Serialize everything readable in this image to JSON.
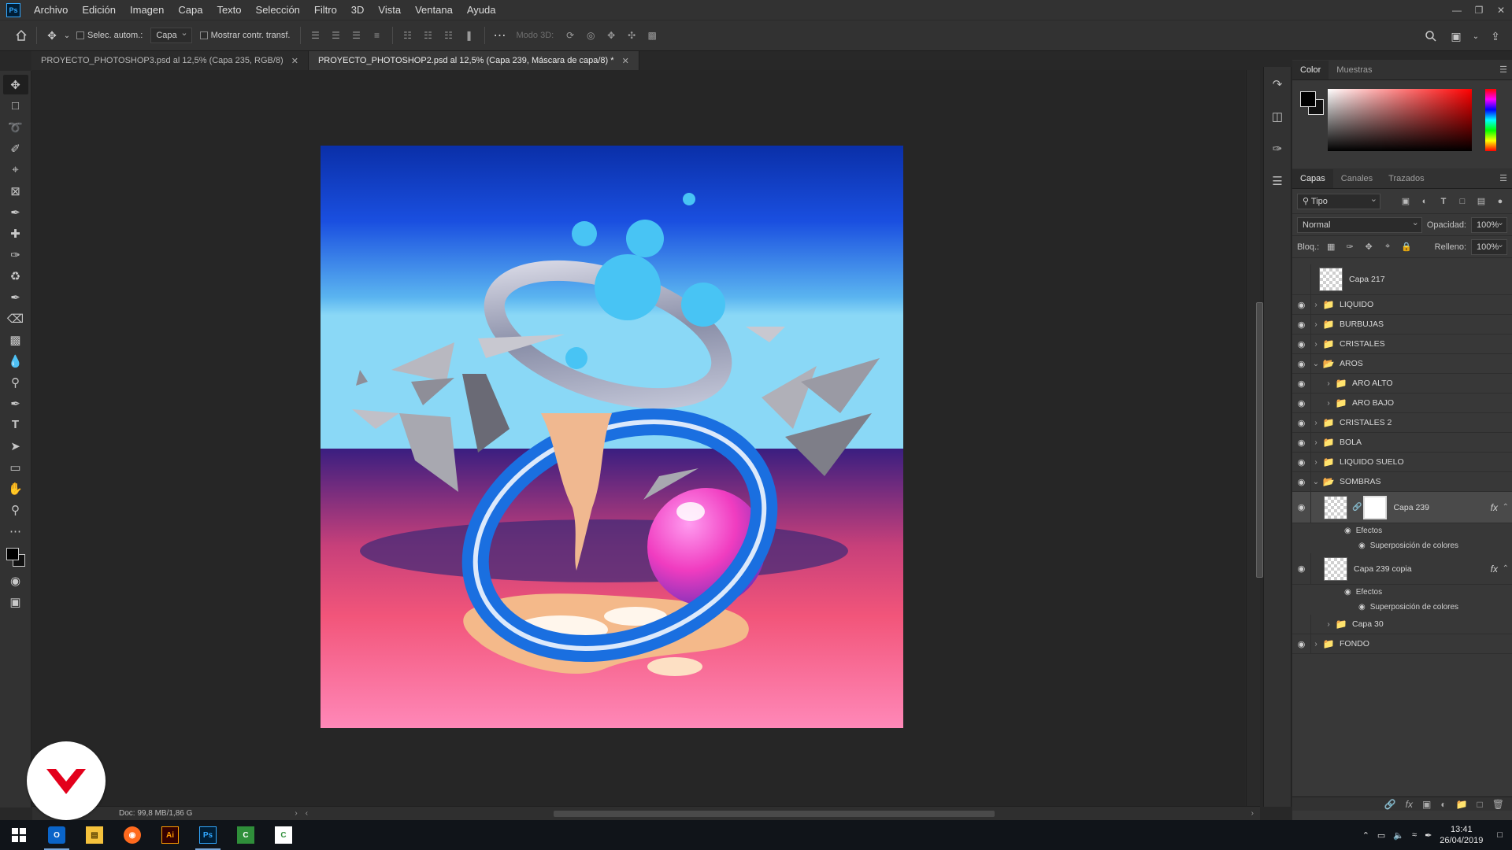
{
  "menubar": {
    "items": [
      "Archivo",
      "Edición",
      "Imagen",
      "Capa",
      "Texto",
      "Selección",
      "Filtro",
      "3D",
      "Vista",
      "Ventana",
      "Ayuda"
    ]
  },
  "options": {
    "auto_select_label": "Selec. autom.:",
    "auto_select_value": "Capa",
    "show_transform_label": "Mostrar contr. transf.",
    "mode3d_label": "Modo 3D:"
  },
  "tabs": [
    {
      "label": "PROYECTO_PHOTOSHOP3.psd al 12,5% (Capa 235, RGB/8)",
      "active": false
    },
    {
      "label": "PROYECTO_PHOTOSHOP2.psd al 12,5% (Capa 239, Máscara de capa/8) *",
      "active": true
    }
  ],
  "status": {
    "doc": "Doc: 99,8 MB/1,86 G"
  },
  "color_panel": {
    "tabs": [
      "Color",
      "Muestras"
    ],
    "foreground": "#000000",
    "background": "#111111"
  },
  "layers_panel": {
    "tabs": [
      "Capas",
      "Canales",
      "Trazados"
    ],
    "filter_value": "Tipo",
    "blend_mode": "Normal",
    "opacity_label": "Opacidad:",
    "opacity_value": "100%",
    "lock_label": "Bloq.:",
    "fill_label": "Relleno:",
    "fill_value": "100%",
    "layers": [
      {
        "name": "Capa 217",
        "type": "layer",
        "visible": false
      },
      {
        "name": "LIQUIDO",
        "type": "group",
        "visible": true
      },
      {
        "name": "BURBUJAS",
        "type": "group",
        "visible": true
      },
      {
        "name": "CRISTALES",
        "type": "group",
        "visible": true
      },
      {
        "name": "AROS",
        "type": "group",
        "visible": true,
        "expanded": true
      },
      {
        "name": "ARO ALTO",
        "type": "group",
        "visible": true,
        "indent": 1
      },
      {
        "name": "ARO BAJO",
        "type": "group",
        "visible": true,
        "indent": 1
      },
      {
        "name": "CRISTALES 2",
        "type": "group",
        "visible": true
      },
      {
        "name": "BOLA",
        "type": "group",
        "visible": true
      },
      {
        "name": "LIQUIDO SUELO",
        "type": "group",
        "visible": true
      },
      {
        "name": "SOMBRAS",
        "type": "group",
        "visible": true,
        "expanded": true
      },
      {
        "name": "Capa 239",
        "type": "layer-mask",
        "visible": true,
        "selected": true
      },
      {
        "name": "Capa 239 copia",
        "type": "layer",
        "visible": true
      },
      {
        "name": "Capa 30",
        "type": "group",
        "visible": false,
        "indent": 1
      },
      {
        "name": "FONDO",
        "type": "group",
        "visible": true
      }
    ],
    "effects_label": "Efectos",
    "effect_name": "Superposición de colores",
    "fx_label": "fx"
  },
  "taskbar": {
    "time": "13:41",
    "date": "26/04/2019"
  },
  "colors": {
    "accent": "#31a8ff",
    "watermark": "#e3001b"
  }
}
